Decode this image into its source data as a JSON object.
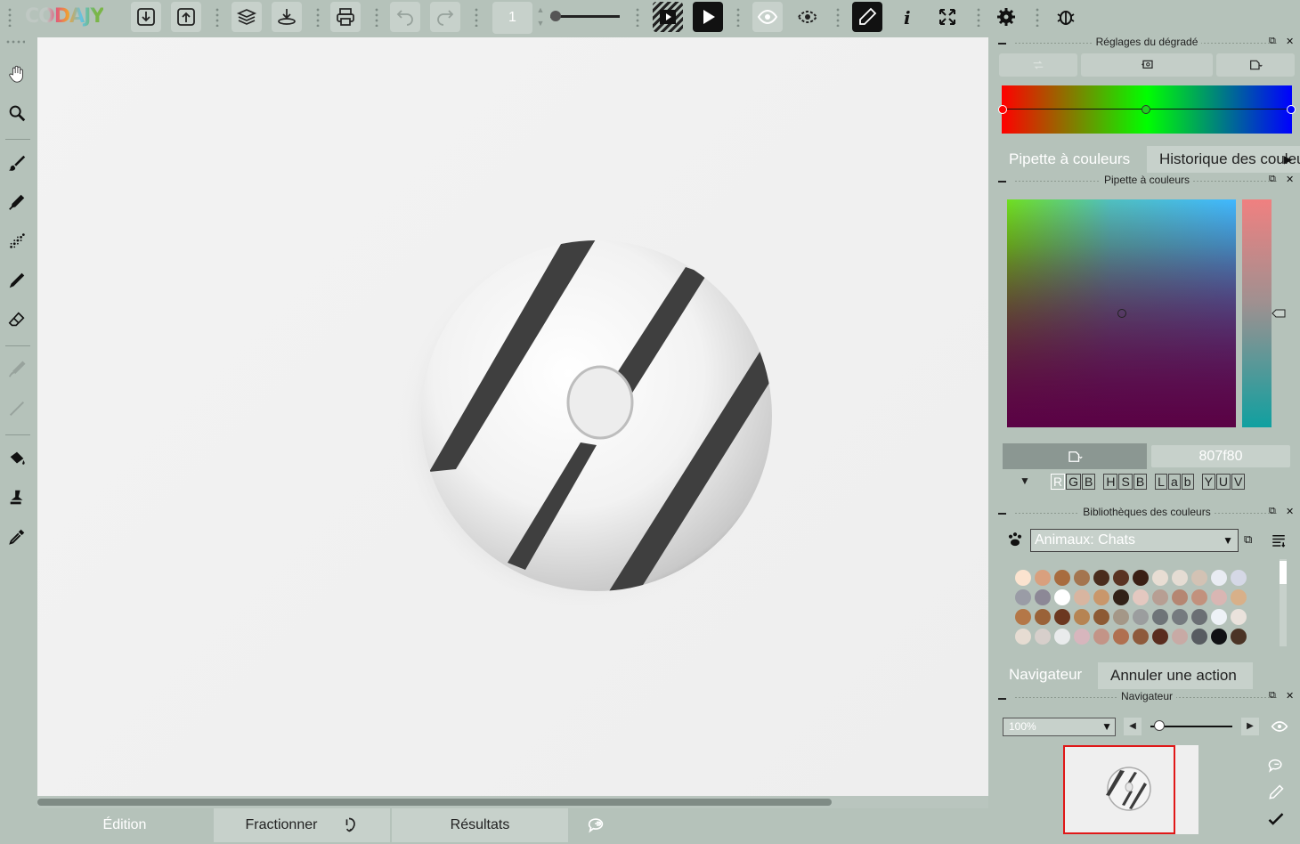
{
  "app": {
    "logo": "CODAJY"
  },
  "toolbar": {
    "frame_value": "1",
    "icons": [
      "import-icon",
      "export-icon",
      "layers-icon",
      "stack-icon",
      "print-icon",
      "undo-icon",
      "redo-icon",
      "frames-icon",
      "play-icon",
      "eye-icon",
      "onion-skin-icon",
      "pencil-pressure-icon",
      "info-icon",
      "fullscreen-icon",
      "settings-icon",
      "bug-icon"
    ]
  },
  "left_tools": [
    "hand-icon",
    "zoom-icon",
    "brush-icon",
    "marker-icon",
    "spray-icon",
    "pen-icon",
    "eraser-icon",
    "smudge-icon",
    "line-icon",
    "bucket-icon",
    "stamp-icon",
    "eyedropper-icon"
  ],
  "bottom_tabs": {
    "edition": "Édition",
    "split": "Fractionner",
    "results": "Résultats"
  },
  "gradient_panel": {
    "title": "Réglages du dégradé",
    "colors": [
      "#ff0000",
      "#00ff00",
      "#0000ff"
    ]
  },
  "color_tabs": {
    "picker": "Pipette à couleurs",
    "history": "Historique des couleurs"
  },
  "picker_panel": {
    "title": "Pipette à couleurs",
    "hex": "807f80",
    "modes": {
      "rgb": [
        "R",
        "G",
        "B"
      ],
      "hsb": [
        "H",
        "S",
        "B"
      ],
      "lab": [
        "L",
        "a",
        "b"
      ],
      "yuv": [
        "Y",
        "U",
        "V"
      ]
    }
  },
  "libraries_panel": {
    "title": "Bibliothèques des couleurs",
    "selected": "Animaux: Chats",
    "swatches": [
      [
        "#fbe3cf",
        "#d9a07e",
        "#a86c3f",
        "#a4754f",
        "#4a2c1d",
        "#5a3322",
        "#3a1f14",
        "#e8ddd3",
        "#e5dcd3",
        "#d3c2b4",
        "#e9ecf3",
        "#d5d8e6"
      ],
      [
        "#9a9ca6",
        "#8c8896",
        "#ffffff",
        "#d8b5a0",
        "#c9976b",
        "#322218",
        "#e4c8c0",
        "#b79e93",
        "#b58672",
        "#c2917d",
        "#d9b6b3",
        "#d8b089"
      ],
      [
        "#b47747",
        "#9a6238",
        "#6c3820",
        "#b68453",
        "#8d5a34",
        "#a49787",
        "#9b9d9e",
        "#6e7478",
        "#757a7f",
        "#6b6f74",
        "#eef2f7",
        "#eae2dc"
      ],
      [
        "#e6dcd2",
        "#d7cfcb",
        "#e9ebec",
        "#d7b6bd",
        "#c39487",
        "#b07050",
        "#8e5a3c",
        "#5a2d1f",
        "#c8aaa5",
        "#585c61",
        "#101114",
        "#4b3426"
      ]
    ]
  },
  "undo_tabs": {
    "navigator": "Navigateur",
    "undo": "Annuler une action"
  },
  "navigator_panel": {
    "title": "Navigateur",
    "zoom": "100%"
  }
}
